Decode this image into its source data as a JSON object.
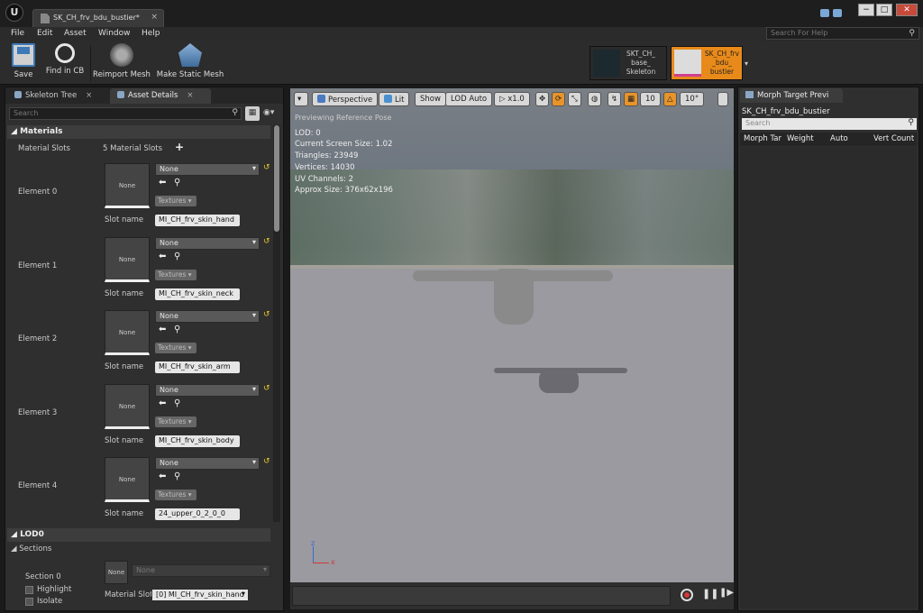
{
  "title_bar": {
    "tab_label": "SK_CH_frv_bdu_bustier*",
    "tab_close": "×",
    "min_label": "−",
    "max_label": "□",
    "close_label": "✕"
  },
  "menu": {
    "items": [
      "File",
      "Edit",
      "Asset",
      "Window",
      "Help"
    ],
    "help_search_placeholder": "Search For Help"
  },
  "toolbar": {
    "save": "Save",
    "find_in_cb": "Find in CB",
    "reimport": "Reimport Mesh",
    "make_static": "Make Static Mesh"
  },
  "asset_cards": {
    "skeleton": "SKT_CH_ base_ Skeleton",
    "mesh": "SK_CH_frv _bdu_ bustier"
  },
  "left_panel": {
    "tabs": [
      "Skeleton Tree",
      "Asset Details"
    ],
    "search_placeholder": "Search",
    "materials_header": "Materials",
    "material_slots_label": "Material Slots",
    "material_slots_value": "5 Material Slots",
    "slot_name_label": "Slot name",
    "textures_label": "Textures",
    "none_label": "None",
    "elements": [
      {
        "label": "Element 0",
        "material": "None",
        "slot": "MI_CH_frv_skin_hand"
      },
      {
        "label": "Element 1",
        "material": "None",
        "slot": "MI_CH_frv_skin_neck"
      },
      {
        "label": "Element 2",
        "material": "None",
        "slot": "MI_CH_frv_skin_arm"
      },
      {
        "label": "Element 3",
        "material": "None",
        "slot": "MI_CH_frv_skin_body"
      },
      {
        "label": "Element 4",
        "material": "None",
        "slot": "24_upper_0_2_0_0"
      }
    ],
    "lod_header": "LOD0",
    "sections_label": "Sections",
    "section0": {
      "label": "Section 0",
      "highlight": "Highlight",
      "isolate": "Isolate",
      "material_none": "None",
      "material_slot_label": "Material Slot",
      "material_slot_value": "[0] MI_CH_frv_skin_hand"
    }
  },
  "viewport": {
    "perspective": "Perspective",
    "lit": "Lit",
    "show": "Show",
    "lod_auto": "LOD Auto",
    "speed": "x1.0",
    "grid_value": "10",
    "angle_value": "10°",
    "preview_text": "Previewing Reference Pose",
    "info": [
      "LOD: 0",
      "Current Screen Size: 1.02",
      "Triangles: 23949",
      "Vertices: 14030",
      "UV Channels: 2",
      "Approx Size: 376x62x196"
    ],
    "axis_z": "z",
    "axis_x": "x"
  },
  "right_panel": {
    "tab": "Morph Target Previ",
    "mesh_name": "SK_CH_frv_bdu_bustier",
    "search_placeholder": "Search",
    "columns": [
      "Morph Tar",
      "Weight",
      "Auto",
      "Vert Count"
    ]
  }
}
